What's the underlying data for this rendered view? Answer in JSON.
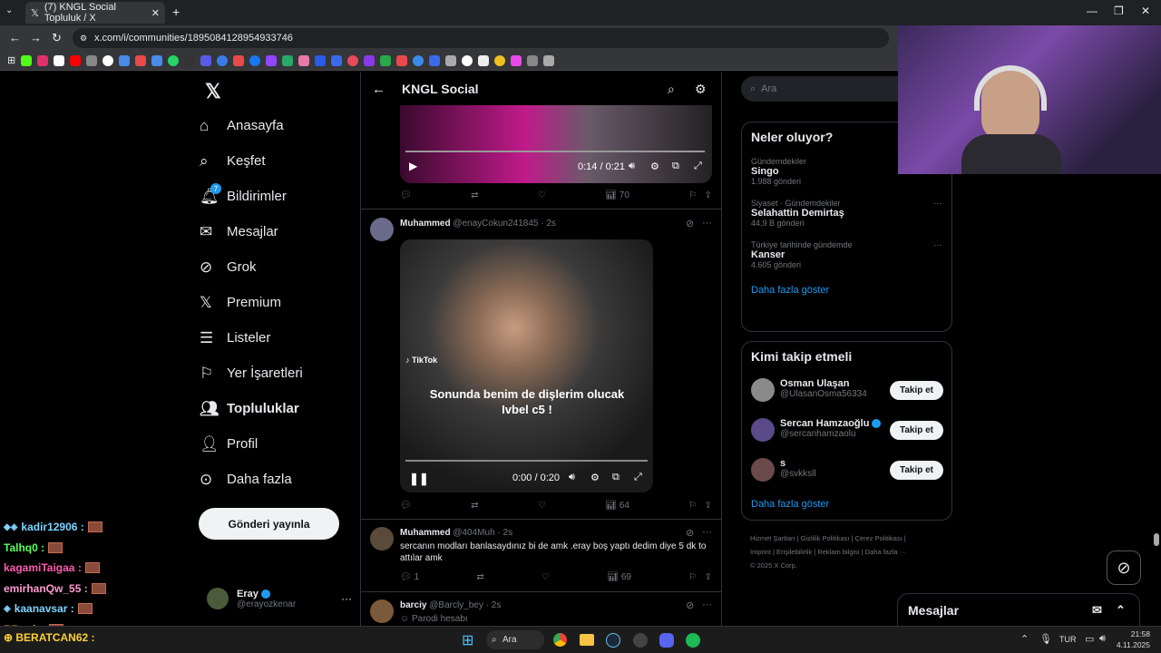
{
  "browser": {
    "tab_title": "(7) KNGL Social Topluluk / X",
    "url": "x.com/i/communities/1895084128954933746"
  },
  "left_nav": {
    "items": [
      {
        "label": "Anasayfa",
        "icon": "home-icon"
      },
      {
        "label": "Keşfet",
        "icon": "search-icon"
      },
      {
        "label": "Bildirimler",
        "icon": "bell-icon",
        "badge": "7"
      },
      {
        "label": "Mesajlar",
        "icon": "mail-icon"
      },
      {
        "label": "Grok",
        "icon": "grok-icon"
      },
      {
        "label": "Premium",
        "icon": "x-icon"
      },
      {
        "label": "Listeler",
        "icon": "list-icon"
      },
      {
        "label": "Yer İşaretleri",
        "icon": "bookmark-icon"
      },
      {
        "label": "Topluluklar",
        "icon": "people-icon"
      },
      {
        "label": "Profil",
        "icon": "person-icon"
      },
      {
        "label": "Daha fazla",
        "icon": "more-circle-icon"
      }
    ],
    "post_button": "Gönderi yayınla",
    "account": {
      "name": "Eray",
      "handle": "@erayozkenar"
    }
  },
  "center": {
    "title": "KNGL Social",
    "tweet1": {
      "time": "0:14 / 0:21",
      "views": "70"
    },
    "tweet2": {
      "name": "Muhammed",
      "handle": "@enayCokun241845",
      "age": "· 2s",
      "video_caption": "Sonunda benim de dişlerim olucak Ivbel c5 !",
      "watermark": "TikTok",
      "time": "0:00 / 0:20",
      "views": "64"
    },
    "tweet3": {
      "name": "Muhammed",
      "handle": "@404Muh",
      "age": "· 2s",
      "text": "sercanın modları banlasaydınız bi de amk .eray boş yaptı dedim diye 5 dk to attılar amk",
      "replies": "1",
      "views": "69"
    },
    "tweet4": {
      "name": "barciy",
      "handle": "@Barcly_bey",
      "age": "· 2s",
      "text": "Parodi hesabı"
    }
  },
  "right": {
    "search_placeholder": "Ara",
    "trends": {
      "title": "Neler oluyor?",
      "items": [
        {
          "context": "Gündemdekiler",
          "name": "Singo",
          "count": "1.988 gönderi"
        },
        {
          "context": "Siyaset · Gündemdekiler",
          "name": "Selahattin Demirtaş",
          "count": "44,9 B gönderi"
        },
        {
          "context": "Türkiye tarihinde gündemde",
          "name": "Kanser",
          "count": "4.605 gönderi"
        }
      ],
      "more": "Daha fazla göster"
    },
    "who_to_follow": {
      "title": "Kimi takip etmeli",
      "items": [
        {
          "name": "Osman Ulaşan",
          "handle": "@UlasanOsma56334",
          "button": "Takip et"
        },
        {
          "name": "Sercan Hamzaoğlu",
          "handle": "@sercanhamzaolu",
          "button": "Takip et"
        },
        {
          "name": "s",
          "handle": "@svkksll",
          "button": "Takip et"
        }
      ],
      "more": "Daha fazla göster"
    },
    "footer": {
      "line1": "Hizmet Şartları  |  Gizlilik Politikası  |  Çerez Politikası  |",
      "line2": "Imprint  |  Erişilebilirlik  |  Reklam bilgisi  |  Daha fazla ···",
      "line3": "© 2025 X Corp."
    }
  },
  "messages_bar": {
    "label": "Mesajlar"
  },
  "chat": [
    {
      "user": "kadir12906 :",
      "color": "#7fd3ff"
    },
    {
      "user": "Talhq0 :",
      "color": "#58ff58"
    },
    {
      "user": "kagamiTaigaa :",
      "color": "#ff5ab0"
    },
    {
      "user": "emirhanQw_55 :",
      "color": "#ff9ad0"
    },
    {
      "user": "kaanavsar :",
      "color": "#7fd3ff"
    },
    {
      "user": "BBunk :",
      "color": "#ffb020"
    },
    {
      "user": "BERATCAN62 :",
      "color": "#ffd030"
    }
  ],
  "taskbar": {
    "search": "Ara",
    "lang": "TUR",
    "time": "21:58",
    "date": "4.11.2025"
  }
}
